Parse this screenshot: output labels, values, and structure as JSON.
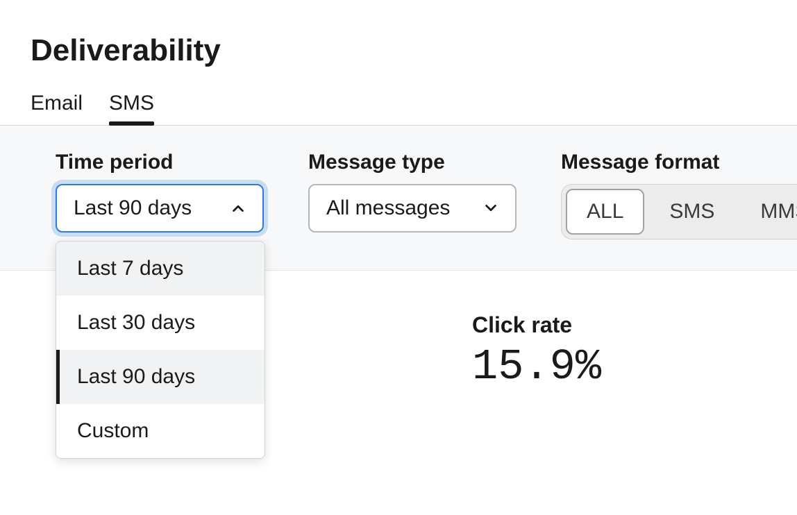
{
  "page": {
    "title": "Deliverability"
  },
  "tabs": {
    "email": "Email",
    "sms": "SMS",
    "active": "sms"
  },
  "filters": {
    "time_period": {
      "label": "Time period",
      "selected": "Last 90 days",
      "options": [
        "Last 7 days",
        "Last 30 days",
        "Last 90 days",
        "Custom"
      ],
      "open": true,
      "hovered_index": 0,
      "selected_index": 2
    },
    "message_type": {
      "label": "Message type",
      "selected": "All messages"
    },
    "message_format": {
      "label": "Message format",
      "options": [
        "ALL",
        "SMS",
        "MMS"
      ],
      "active": "ALL"
    }
  },
  "metrics": {
    "click_rate": {
      "label": "Click rate",
      "value": "15.9%"
    }
  }
}
